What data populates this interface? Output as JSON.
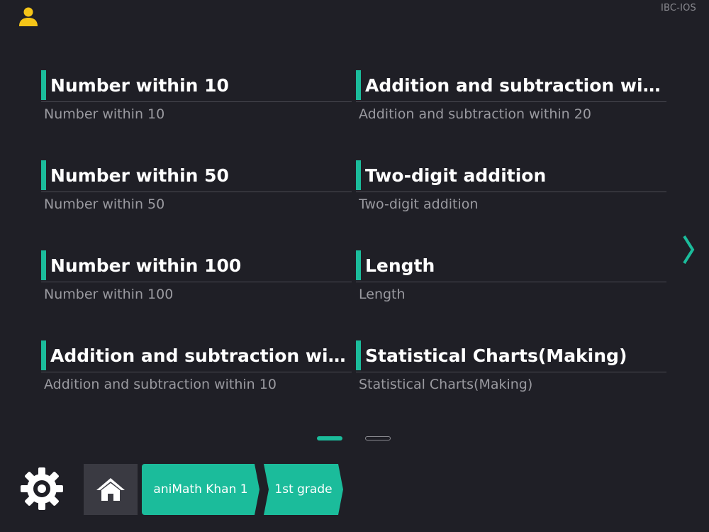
{
  "header": {
    "version_label": "IBC-IOS",
    "user_icon": "user-icon"
  },
  "topics": [
    {
      "title": "Number within 10",
      "subtitle": "Number within 10"
    },
    {
      "title": "Addition and subtraction within 20",
      "subtitle": "Addition and subtraction within 20"
    },
    {
      "title": "Number within 50",
      "subtitle": "Number within 50"
    },
    {
      "title": "Two-digit addition",
      "subtitle": "Two-digit addition"
    },
    {
      "title": "Number within 100",
      "subtitle": "Number within 100"
    },
    {
      "title": "Length",
      "subtitle": "Length"
    },
    {
      "title": "Addition and subtraction within 10",
      "subtitle": "Addition and subtraction within 10"
    },
    {
      "title": "Statistical Charts(Making)",
      "subtitle": "Statistical Charts(Making)"
    }
  ],
  "pager": {
    "pages": 2,
    "current_page": 1
  },
  "footer": {
    "settings_icon": "gear-icon",
    "home_icon": "home-icon",
    "breadcrumb": [
      "aniMath Khan 1",
      "1st grade"
    ]
  },
  "colors": {
    "background": "#1f1f26",
    "accent": "#1bbc9b",
    "user_icon": "#f5c518",
    "subtitle_text": "#9a9aa0",
    "home_button": "#3a3a42"
  }
}
